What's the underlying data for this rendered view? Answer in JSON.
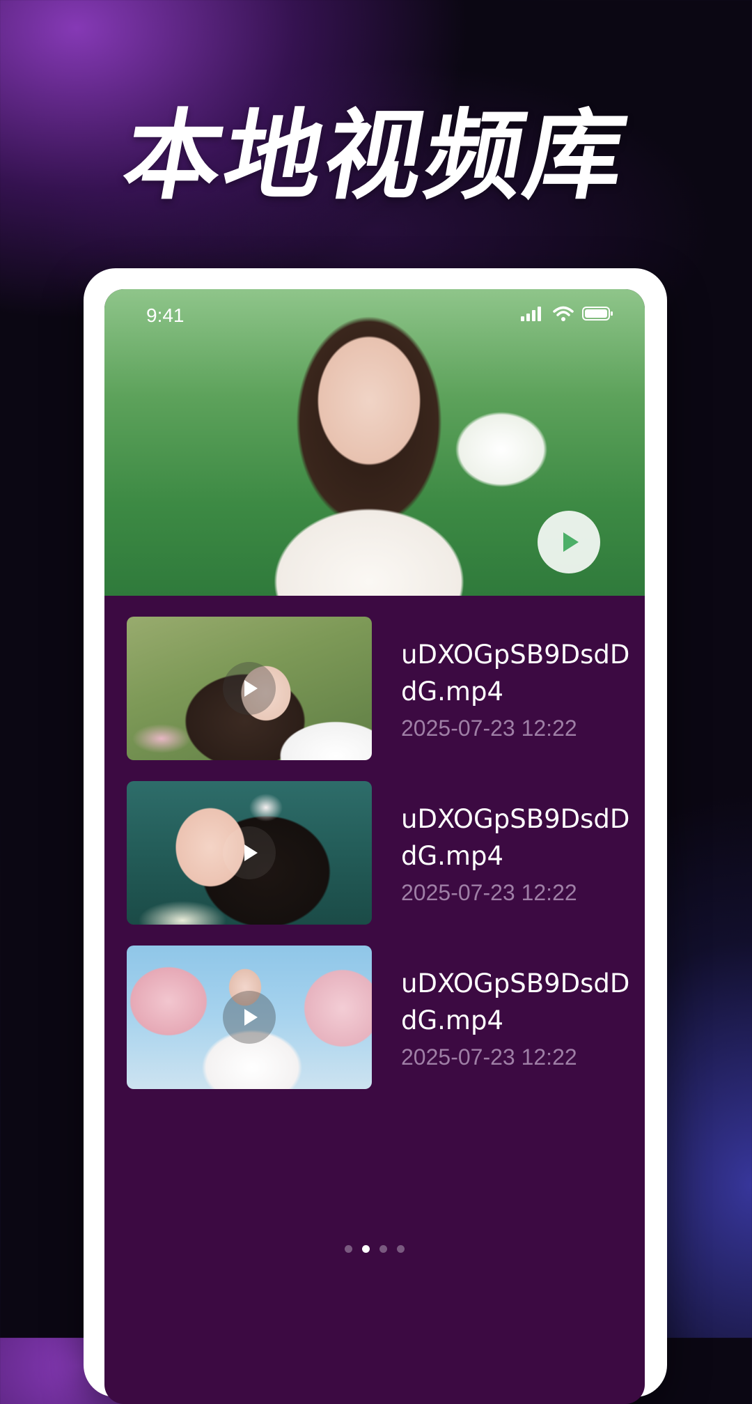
{
  "headline": "本地视频库",
  "status_bar": {
    "time": "9:41"
  },
  "hero": {
    "play_icon": "play-icon"
  },
  "videos": [
    {
      "name": "uDXOGpSB9DsdDdG.mp4",
      "date": "2025-07-23 12:22"
    },
    {
      "name": "uDXOGpSB9DsdDdG.mp4",
      "date": "2025-07-23 12:22"
    },
    {
      "name": "uDXOGpSB9DsdDdG.mp4",
      "date": "2025-07-23 12:22"
    }
  ],
  "pagination": {
    "count": 4,
    "active_index": 1
  },
  "colors": {
    "screen_bg": "#3c0a42",
    "date_text": "#9f7fa6",
    "accent_purple": "#8c3cbe"
  }
}
